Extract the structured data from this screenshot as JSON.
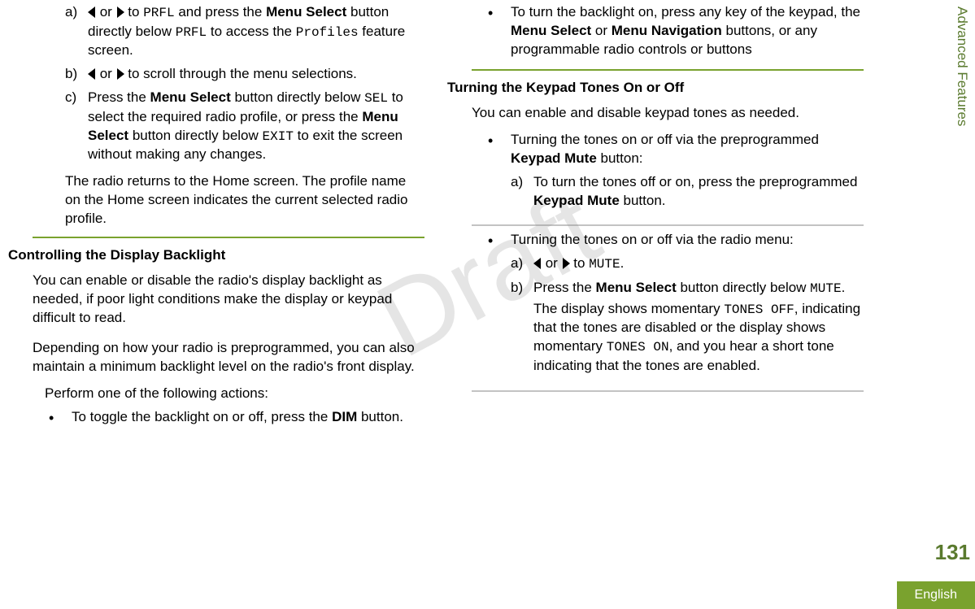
{
  "side_tab": "Advanced Features",
  "page_number": "131",
  "language": "English",
  "watermark": "Draft",
  "left": {
    "steps_a": {
      "a": {
        "text1": " or ",
        "text2": " to ",
        "code1": "PRFL",
        "text3": " and press the ",
        "b1": "Menu Select",
        "text4": " button directly below ",
        "code2": "PRFL",
        "text5": " to access the ",
        "code3": "Profiles",
        "text6": " feature screen."
      },
      "b": {
        "text1": " or ",
        "text2": " to scroll through the menu selections."
      },
      "c": {
        "text1": "Press the ",
        "b1": "Menu Select",
        "text2": " button directly below ",
        "code1": "SEL",
        "text3": " to select the required radio profile, or press the ",
        "b2": "Menu Select",
        "text4": " button directly below ",
        "code2": "EXIT",
        "text5": " to exit the screen without making any changes."
      }
    },
    "after_steps": "The radio returns to the Home screen. The profile name on the Home screen indicates the current selected radio profile.",
    "h2": "Controlling the Display Backlight",
    "p1": "You can enable or disable the radio's display backlight as needed, if poor light conditions make the display or keypad difficult to read.",
    "p2": "Depending on how your radio is preprogrammed, you can also maintain a minimum backlight level on the radio's front display.",
    "perform": "Perform one of the following actions:",
    "bul1": {
      "t1": "To toggle the backlight on or off, press the ",
      "b1": "DIM",
      "t2": " button."
    }
  },
  "right": {
    "bul2": {
      "t1": "To turn the backlight on, press any key of the keypad, the ",
      "b1": "Menu Select",
      "t2": " or ",
      "b2": "Menu Navigation",
      "t3": " buttons, or any programmable radio controls or buttons"
    },
    "h2": "Turning the Keypad Tones On or Off",
    "p1": "You can enable and disable keypad tones as needed.",
    "bul3": {
      "t1": "Turning the tones on or off via the preprogrammed ",
      "b1": "Keypad Mute",
      "t2": " button:"
    },
    "bul3a": {
      "t1": "To turn the tones off or on, press the preprogrammed ",
      "b1": "Keypad Mute",
      "t2": " button."
    },
    "bul4": "Turning the tones on or off via the radio menu:",
    "bul4a": {
      "text1": " or ",
      "text2": " to ",
      "code1": "MUTE",
      "text3": "."
    },
    "bul4b": {
      "t1": "Press the ",
      "b1": "Menu Select",
      "t2": " button directly below ",
      "code1": "MUTE",
      "t3": ".",
      "t4": "The display shows momentary ",
      "code2": "TONES OFF",
      "t5": ", indicating that the tones are disabled or the display shows momentary ",
      "code3": "TONES ON",
      "t6": ", and you hear a short tone indicating that the tones are enabled."
    }
  }
}
